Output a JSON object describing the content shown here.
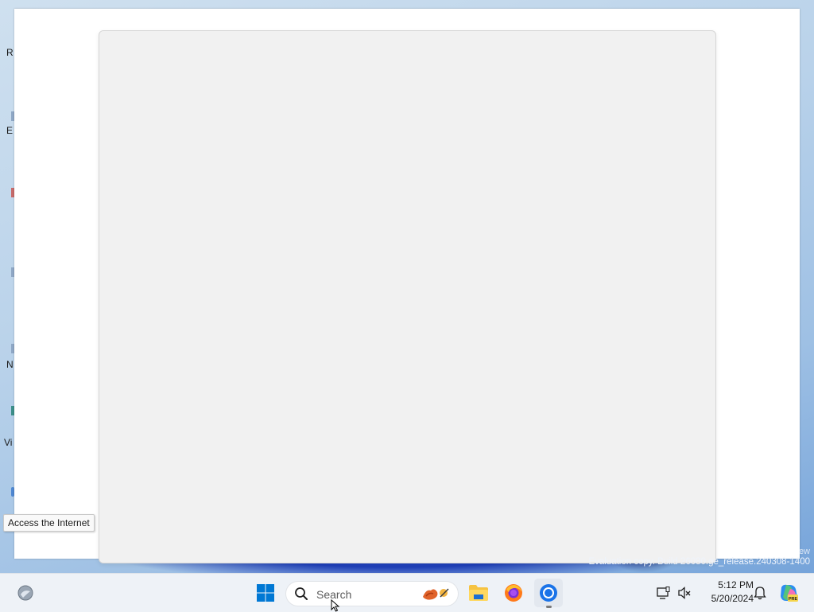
{
  "desktop": {
    "icon_labels": [
      "R",
      "E",
      "N",
      "Vi"
    ]
  },
  "tooltip": {
    "text": "Access the Internet"
  },
  "watermark": {
    "top_fragment": "ew",
    "text": "Evaluation copy. Build 26080.ge_release.240308-1400"
  },
  "taskbar": {
    "search": {
      "placeholder": "Search"
    },
    "apps": [
      {
        "name": "File Explorer",
        "icon": "folder-icon"
      },
      {
        "name": "Firefox",
        "icon": "firefox-icon"
      },
      {
        "name": "Chrome",
        "icon": "chrome-icon"
      }
    ],
    "clock": {
      "time": "5:12 PM",
      "date": "5/20/2024"
    }
  },
  "colors": {
    "windows_blue": "#0078d4",
    "taskbar_bg": "#eef2f7",
    "panel_bg": "#f1f1f1"
  }
}
